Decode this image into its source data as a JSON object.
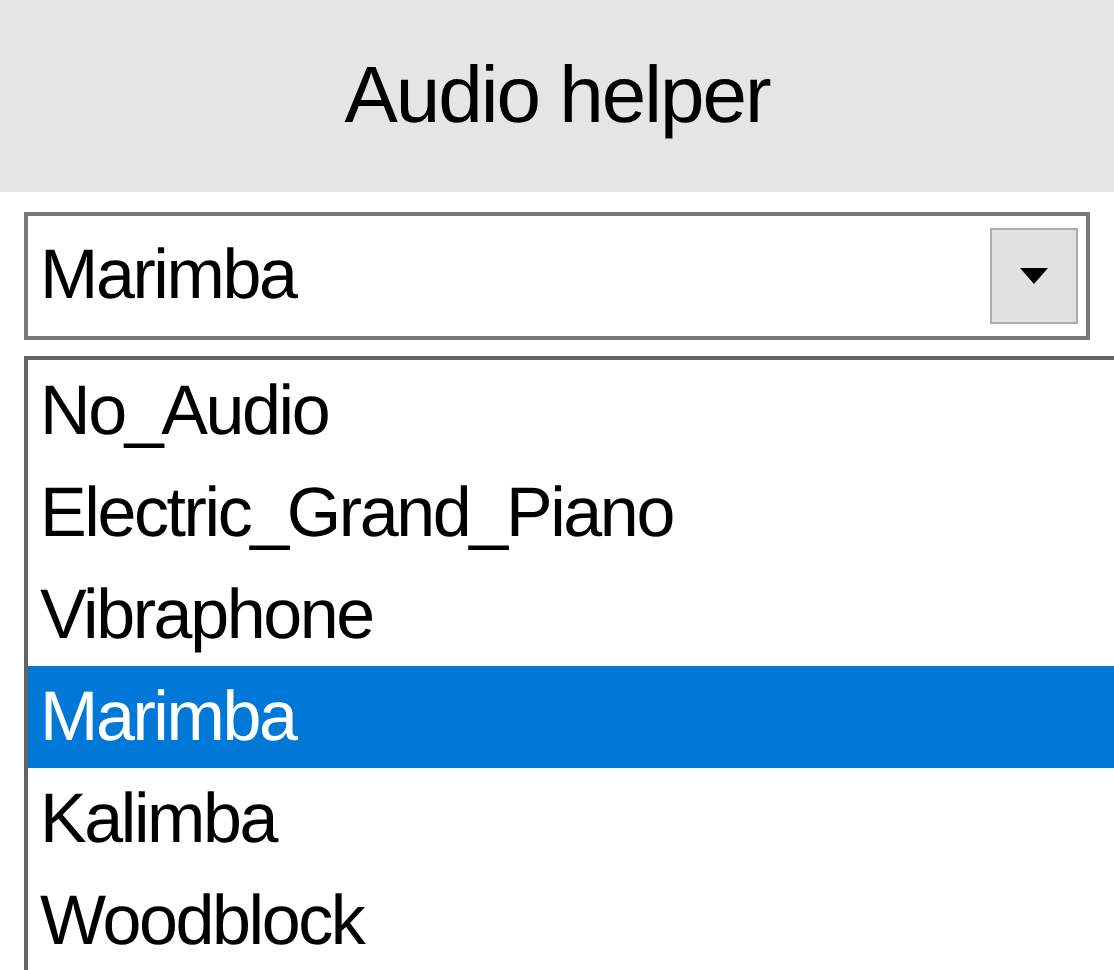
{
  "title": "Audio helper",
  "dropdown": {
    "value": "Marimba",
    "expanded": true
  },
  "options": [
    {
      "label": "No_Audio",
      "selected": false
    },
    {
      "label": "Electric_Grand_Piano",
      "selected": false
    },
    {
      "label": "Vibraphone",
      "selected": false
    },
    {
      "label": "Marimba",
      "selected": true
    },
    {
      "label": "Kalimba",
      "selected": false
    },
    {
      "label": "Woodblock",
      "selected": false
    }
  ]
}
